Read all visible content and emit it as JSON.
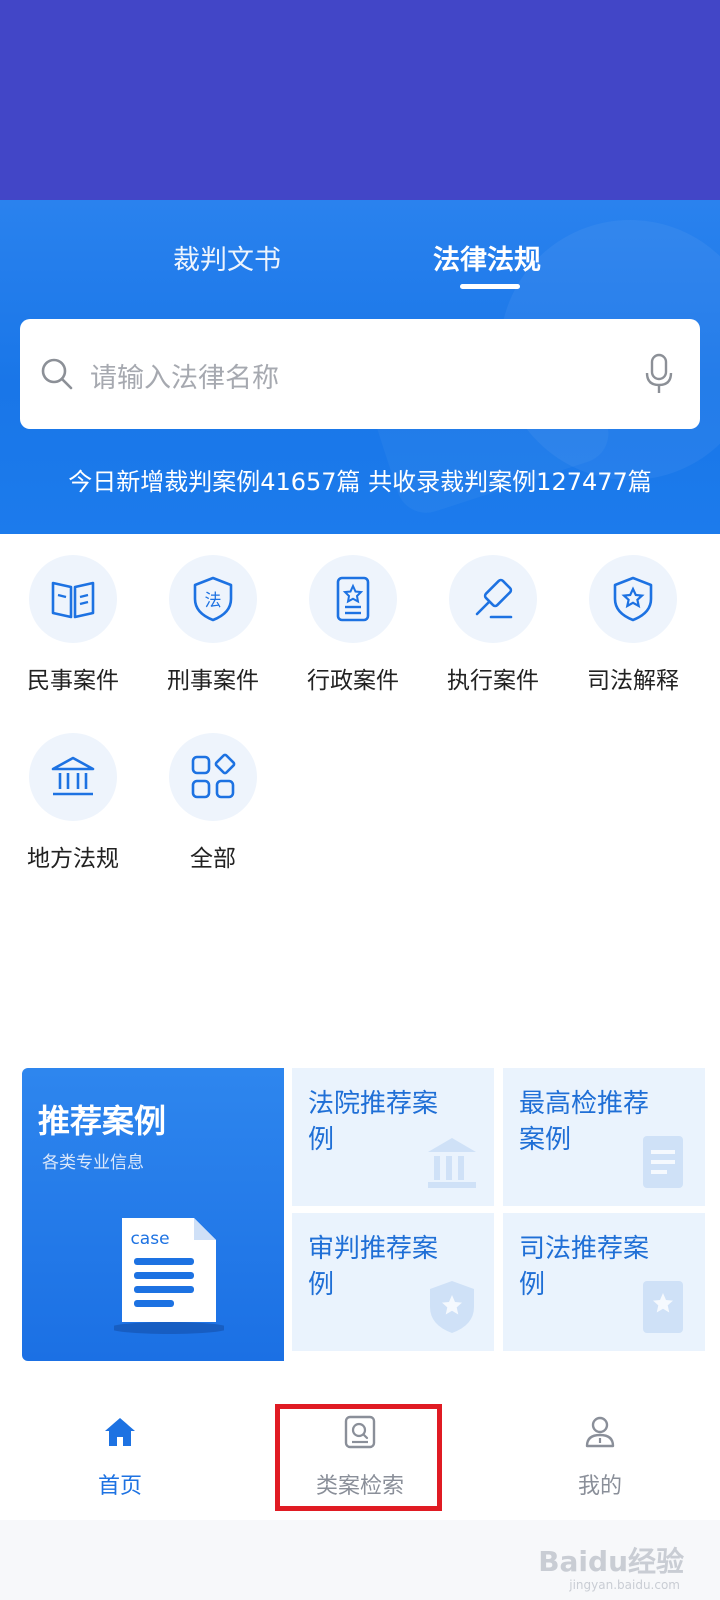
{
  "tabs": [
    {
      "label": "裁判文书",
      "active": false
    },
    {
      "label": "法律法规",
      "active": true
    }
  ],
  "search": {
    "placeholder": "请输入法律名称"
  },
  "stats_text": "今日新增裁判案例41657篇 共收录裁判案例127477篇",
  "categories": [
    {
      "label": "民事案件",
      "icon": "book-icon"
    },
    {
      "label": "刑事案件",
      "icon": "shield-law-icon"
    },
    {
      "label": "行政案件",
      "icon": "document-star-icon"
    },
    {
      "label": "执行案件",
      "icon": "gavel-icon"
    },
    {
      "label": "司法解释",
      "icon": "shield-star-icon"
    },
    {
      "label": "地方法规",
      "icon": "courthouse-icon"
    },
    {
      "label": "全部",
      "icon": "grid-icon"
    }
  ],
  "recommend": {
    "title": "推荐案例",
    "subtitle": "各类专业信息",
    "doc_label": "case",
    "cards": [
      {
        "label": "法院推荐案例",
        "icon": "courthouse-icon"
      },
      {
        "label": "最高检推荐案例",
        "icon": "document-icon"
      },
      {
        "label": "审判推荐案例",
        "icon": "shield-star-icon"
      },
      {
        "label": "司法推荐案例",
        "icon": "document-star-icon"
      }
    ]
  },
  "bottom_nav": [
    {
      "label": "首页",
      "icon": "home-icon",
      "active": true
    },
    {
      "label": "类案检索",
      "icon": "case-search-icon",
      "active": false
    },
    {
      "label": "我的",
      "icon": "user-icon",
      "active": false
    }
  ],
  "watermark": {
    "text": "Baidu经验",
    "sub": "jingyan.baidu.com"
  },
  "colors": {
    "accent": "#1d72e2",
    "top_bar": "#4246c7",
    "highlight": "#e01b23"
  }
}
